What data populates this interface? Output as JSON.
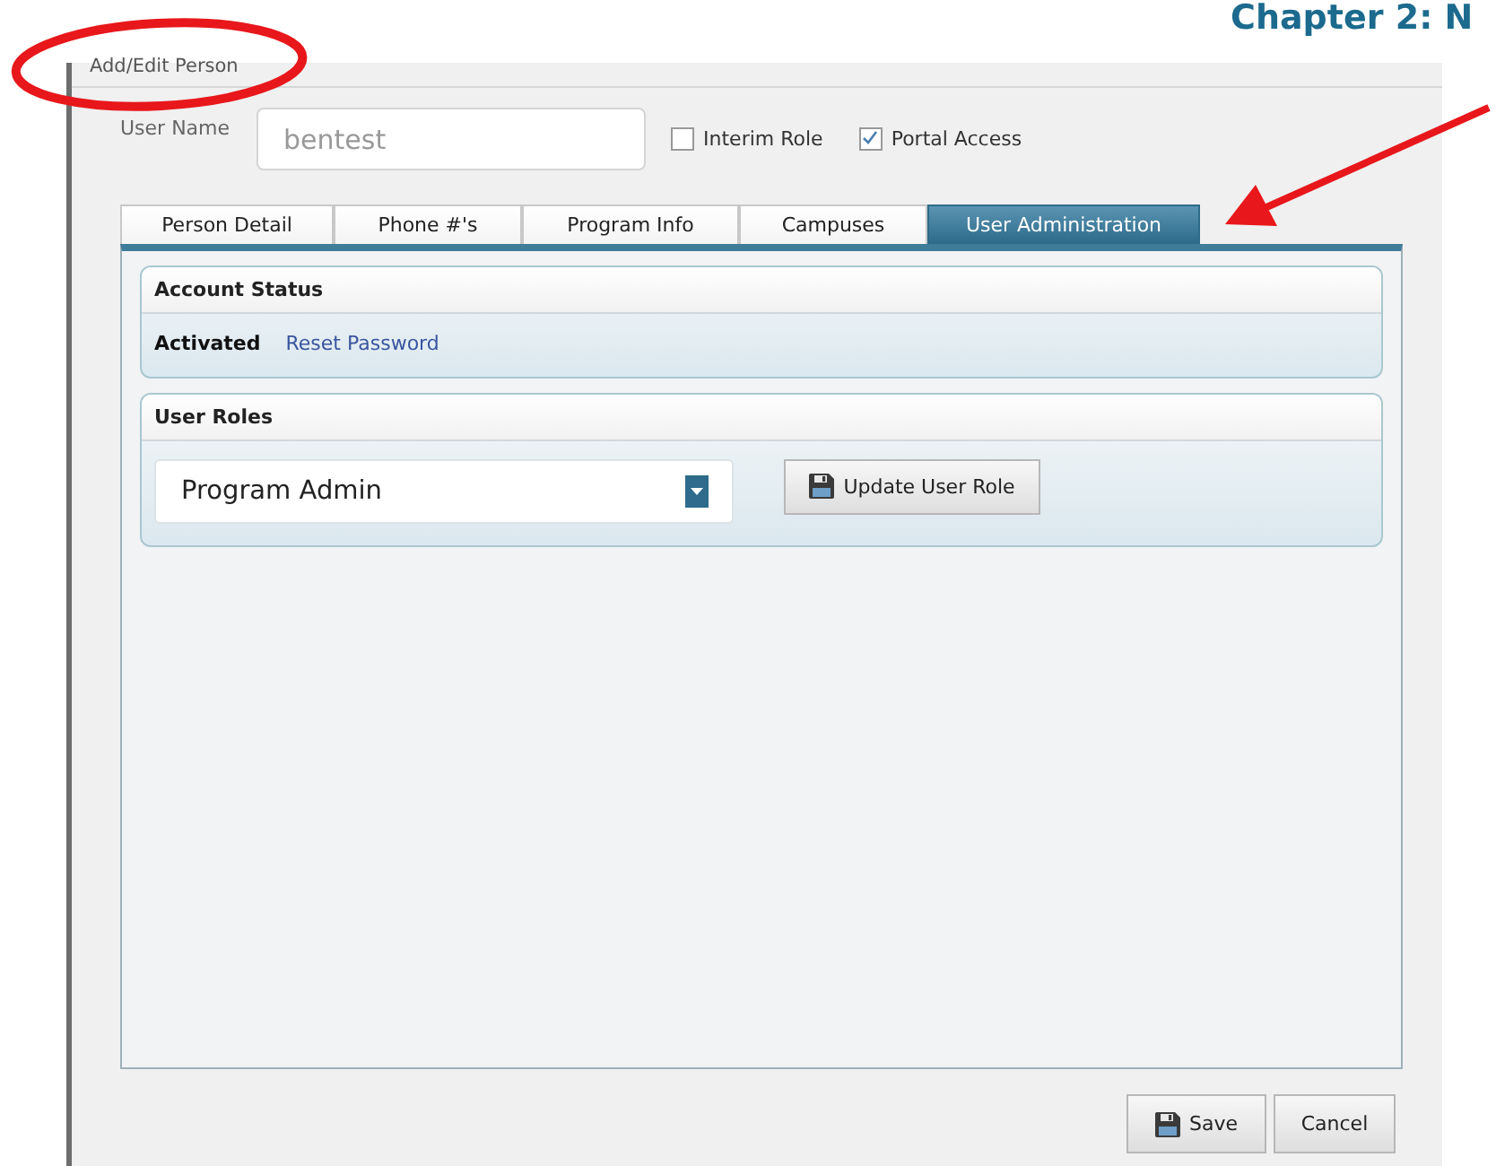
{
  "document_heading": "Chapter 2: N",
  "window": {
    "title": "Add/Edit Person"
  },
  "user_name": {
    "label": "User Name",
    "value": "bentest"
  },
  "options": [
    {
      "label": "Interim Role",
      "checked": false
    },
    {
      "label": "Portal Access",
      "checked": true
    }
  ],
  "tabs": [
    {
      "label": "Person Detail",
      "selected": false
    },
    {
      "label": "Phone #'s",
      "selected": false
    },
    {
      "label": "Program Info",
      "selected": false
    },
    {
      "label": "Campuses",
      "selected": false
    },
    {
      "label": "User Administration",
      "selected": true
    }
  ],
  "account_status": {
    "title": "Account Status",
    "status": "Activated",
    "link": "Reset Password"
  },
  "user_roles": {
    "title": "User Roles",
    "role": "Program Admin",
    "button": {
      "label": "Update User Role",
      "kind": "icon-button"
    }
  },
  "buttons": [
    {
      "label": "Save",
      "kind": "icon-button"
    },
    {
      "label": "Cancel",
      "kind": "plain"
    }
  ]
}
